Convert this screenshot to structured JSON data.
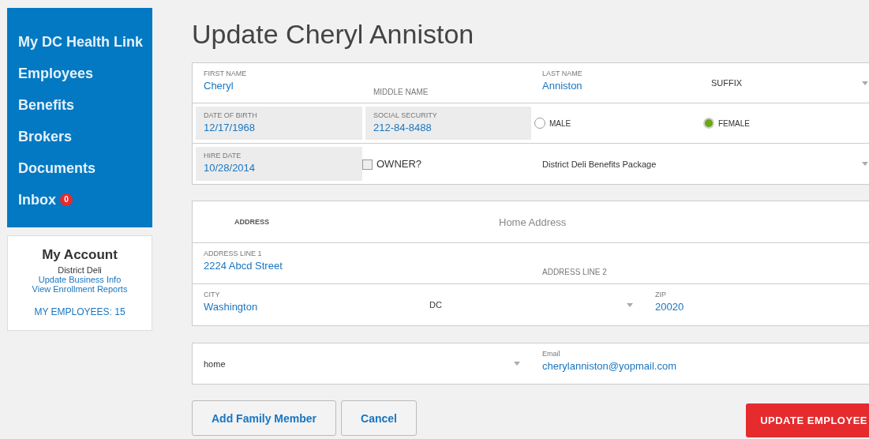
{
  "sidebar": {
    "nav": [
      {
        "label": "My DC Health Link"
      },
      {
        "label": "Employees"
      },
      {
        "label": "Benefits"
      },
      {
        "label": "Brokers"
      },
      {
        "label": "Documents"
      },
      {
        "label": "Inbox",
        "badge": "0"
      }
    ],
    "account": {
      "title": "My Account",
      "company": "District Deli",
      "links": [
        "Update Business Info",
        "View Enrollment Reports"
      ],
      "employees": "MY EMPLOYEES: 15"
    }
  },
  "title": "Update Cheryl Anniston",
  "personal": {
    "first_name": {
      "label": "FIRST NAME",
      "value": "Cheryl"
    },
    "middle_name": {
      "placeholder": "MIDDLE NAME"
    },
    "last_name": {
      "label": "LAST NAME",
      "value": "Anniston"
    },
    "suffix": {
      "placeholder": "SUFFIX"
    },
    "dob": {
      "label": "DATE OF BIRTH",
      "value": "12/17/1968"
    },
    "ssn": {
      "label": "SOCIAL SECURITY",
      "value": "212-84-8488"
    },
    "gender": [
      {
        "label": "MALE",
        "selected": false
      },
      {
        "label": "FEMALE",
        "selected": true
      }
    ],
    "hire_date": {
      "label": "HIRE DATE",
      "value": "10/28/2014"
    },
    "owner": {
      "label": "OWNER?",
      "checked": false
    },
    "benefit_package": {
      "value": "District Deli Benefits Package"
    }
  },
  "address": {
    "header": "ADDRESS",
    "kind": "Home Address",
    "line1": {
      "label": "ADDRESS LINE 1",
      "value": "2224 Abcd Street"
    },
    "line2": {
      "placeholder": "ADDRESS LINE 2"
    },
    "city": {
      "label": "CITY",
      "value": "Washington"
    },
    "state": {
      "value": "DC"
    },
    "zip": {
      "label": "ZIP",
      "value": "20020"
    }
  },
  "contact": {
    "email_kind": {
      "value": "home"
    },
    "email": {
      "label": "Email",
      "value": "cherylanniston@yopmail.com"
    }
  },
  "buttons": [
    {
      "label": "Add Family Member",
      "kind": "secondary"
    },
    {
      "label": "Cancel",
      "kind": "secondary"
    },
    {
      "label": "UPDATE EMPLOYEE",
      "kind": "primary"
    }
  ]
}
